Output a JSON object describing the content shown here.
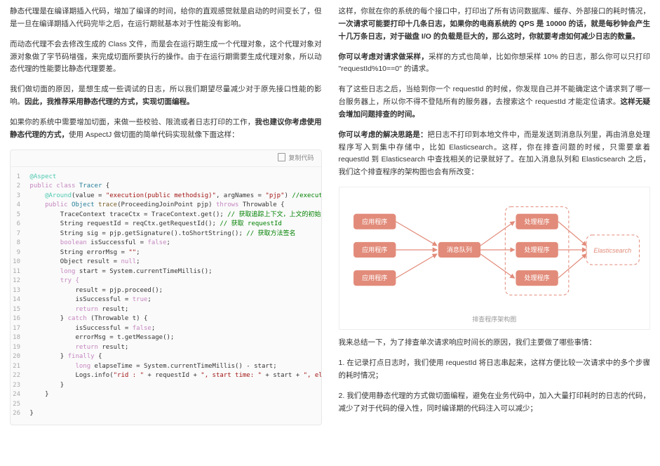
{
  "left": {
    "p1a": "静态代理是在编译期插入代码，增加了编译的时间，给你的直观感觉就是启动的时间变长了，但是一旦在编译期插入代码完毕之后，在运行期就基本对于性能没有影响。",
    "p2": "而动态代理不会去修改生成的 Class 文件，而是会在运行期生成一个代理对象，这个代理对象对源对象做了字节码增强，来完成切面所要执行的操作。由于在运行期需要生成代理对象，所以动态代理的性能要比静态代理要差。",
    "p3a": "我们做切面的原因，是想生成一些调试的日志，所以我们期望尽量减少对于原先接口性能的影响。",
    "p3b": "因此，我推荐采用静态代理的方式，实现切面编程。",
    "p4a": "如果你的系统中需要增加切面，来做一些校验、限流或者日志打印的工作，",
    "p4b": "我也建议你考虑使用静态代理的方式，",
    "p4c": "使用 AspectJ 做切面的简单代码实现就像下面这样：",
    "copy": "复制代码"
  },
  "code": {
    "l1": "@Aspect",
    "l2_a": "public",
    "l2_b": "class",
    "l2_c": "Tracer",
    "l3_a": "@Around",
    "l3_b": "(value = ",
    "l3_c": "\"execution(public methodsig)\"",
    "l3_d": ", argNames = ",
    "l3_e": "\"pjp\"",
    "l3_f": ") ",
    "l3_g": "//executi",
    "l4_a": "public",
    "l4_b": "Object",
    "l4_c": "trace",
    "l4_d": "(ProceedingJoinPoint pjp)",
    "l4_e": " throws ",
    "l4_f": "Throwable {",
    "l5_a": "TraceContext traceCtx = TraceContext.get(); ",
    "l5_b": "// 获取追踪上下文，上文的初始",
    "l6_a": "String requestId = reqCtx.getRequestId(); ",
    "l6_b": "// 获取 requestId",
    "l7_a": "String sig = pjp.getSignature().toShortString(); ",
    "l7_b": "// 获取方法签名",
    "l8_a": "boolean",
    "l8_b": " isSuccessful = ",
    "l8_c": "false",
    "l8_d": ";",
    "l9_a": "String errorMsg = ",
    "l9_b": "\"\"",
    "l9_c": ";",
    "l10_a": "Object result = ",
    "l10_b": "null",
    "l10_c": ";",
    "l11_a": "long",
    "l11_b": " start = System.currentTimeMillis();",
    "l12": "try {",
    "l13": "result = pjp.proceed();",
    "l14_a": "isSuccessful = ",
    "l14_b": "true",
    "l14_c": ";",
    "l15_a": "return",
    "l15_b": " result;",
    "l16_a": "} ",
    "l16_b": "catch",
    "l16_c": " (Throwable t) {",
    "l17_a": "isSuccessful = ",
    "l17_b": "false",
    "l17_c": ";",
    "l18": "errorMsg = t.getMessage();",
    "l19_a": "return",
    "l19_b": " result;",
    "l20_a": "} ",
    "l20_b": "finally",
    "l20_c": " {",
    "l21_a": "long",
    "l21_b": " elapseTime = System.currentTimeMillis() - start;",
    "l22_a": "Logs.info(",
    "l22_b": "\"rid : \"",
    "l22_c": " + requestId + ",
    "l22_d": "\", start time: \"",
    "l22_e": " + start + ",
    "l22_f": "\", ela",
    "l23": "}",
    "l24": "}",
    "l26": "}"
  },
  "right": {
    "p1a": "这样，你就在你的系统的每个接口中，打印出了所有访问数据库、缓存、外部接口的耗时情况，",
    "p1b": "一次请求可能要打印十几条日志，如果你的电商系统的 QPS 是 10000 的话，就是每秒钟会产生十几万条日志，对于磁盘 I/O 的负载是巨大的，",
    "p1c": "那么这时，你就要考虑如何减少日志的数量。",
    "p2a": "你可以考虑对请求做采样，",
    "p2b": "采样的方式也简单，比如你想采样 10% 的日志，那么你可以只打印  \"requestId%10==0\" 的请求。",
    "p3a": "有了这些日志之后，当给到你一个 requestId 的时候，你发现自己并不能确定这个请求到了哪一台服务器上，所以你不得不登陆所有的服务器，去搜索这个 requestId 才能定位请求。",
    "p3b": "这样无疑会增加问题排查的时间。",
    "p4a": "你可以考虑的解决思路是：",
    "p4b": "把日志不打印到本地文件中，而是发送到消息队列里，再由消息处理程序写入到集中存储中，比如 Elasticsearch。这样，你在排查问题的时候，只需要拿着 requestId 到 Elasticsearch 中查找相关的记录就好了。在加入消息队列和 Elasticsearch 之后，我们这个排查程序的架构图也会有所改变：",
    "caption": "排查程序架构图",
    "p5": "我来总结一下，为了排查单次请求响应时间长的原因，我们主要做了哪些事情：",
    "p6": "1. 在记录打点日志时，我们使用 requestId 将日志串起来，这样方便比较一次请求中的多个步骤的耗时情况；",
    "p7": "2. 我们使用静态代理的方式做切面编程，避免在业务代码中，加入大量打印耗时的日志的代码，减少了对于代码的侵入性，同时编译期的代码注入可以减少；"
  },
  "diagram": {
    "app": "应用程序",
    "queue": "消息队列",
    "processor": "处理程序",
    "es": "Elasticsearch"
  }
}
